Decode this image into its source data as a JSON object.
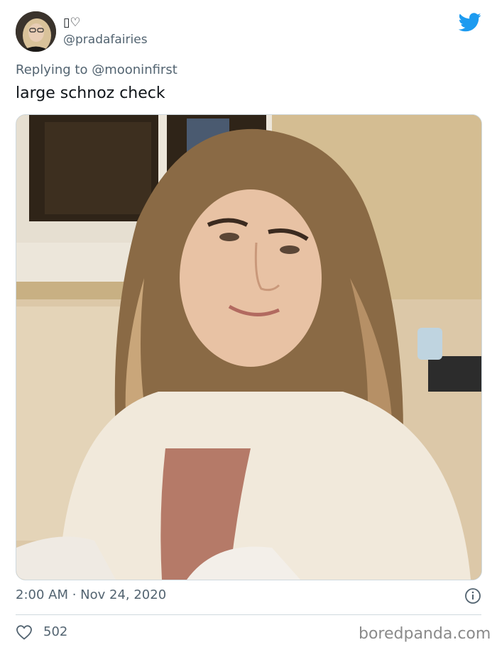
{
  "tweet": {
    "author": {
      "display_name": "▯♡",
      "handle": "@pradafairies"
    },
    "reply_prefix": "Replying to",
    "reply_to": "@mooninfirst",
    "text": "large schnoz check",
    "timestamp": "2:00 AM · Nov 24, 2020",
    "like_count": "502",
    "icons": [
      "twitter-bird-icon",
      "info-icon",
      "heart-icon"
    ],
    "colors": {
      "accent": "#1d9bf0",
      "secondary_text": "#536471",
      "text": "#0f1419",
      "divider": "#cfd9de"
    }
  },
  "watermark": {
    "text": "boredpanda.com"
  }
}
